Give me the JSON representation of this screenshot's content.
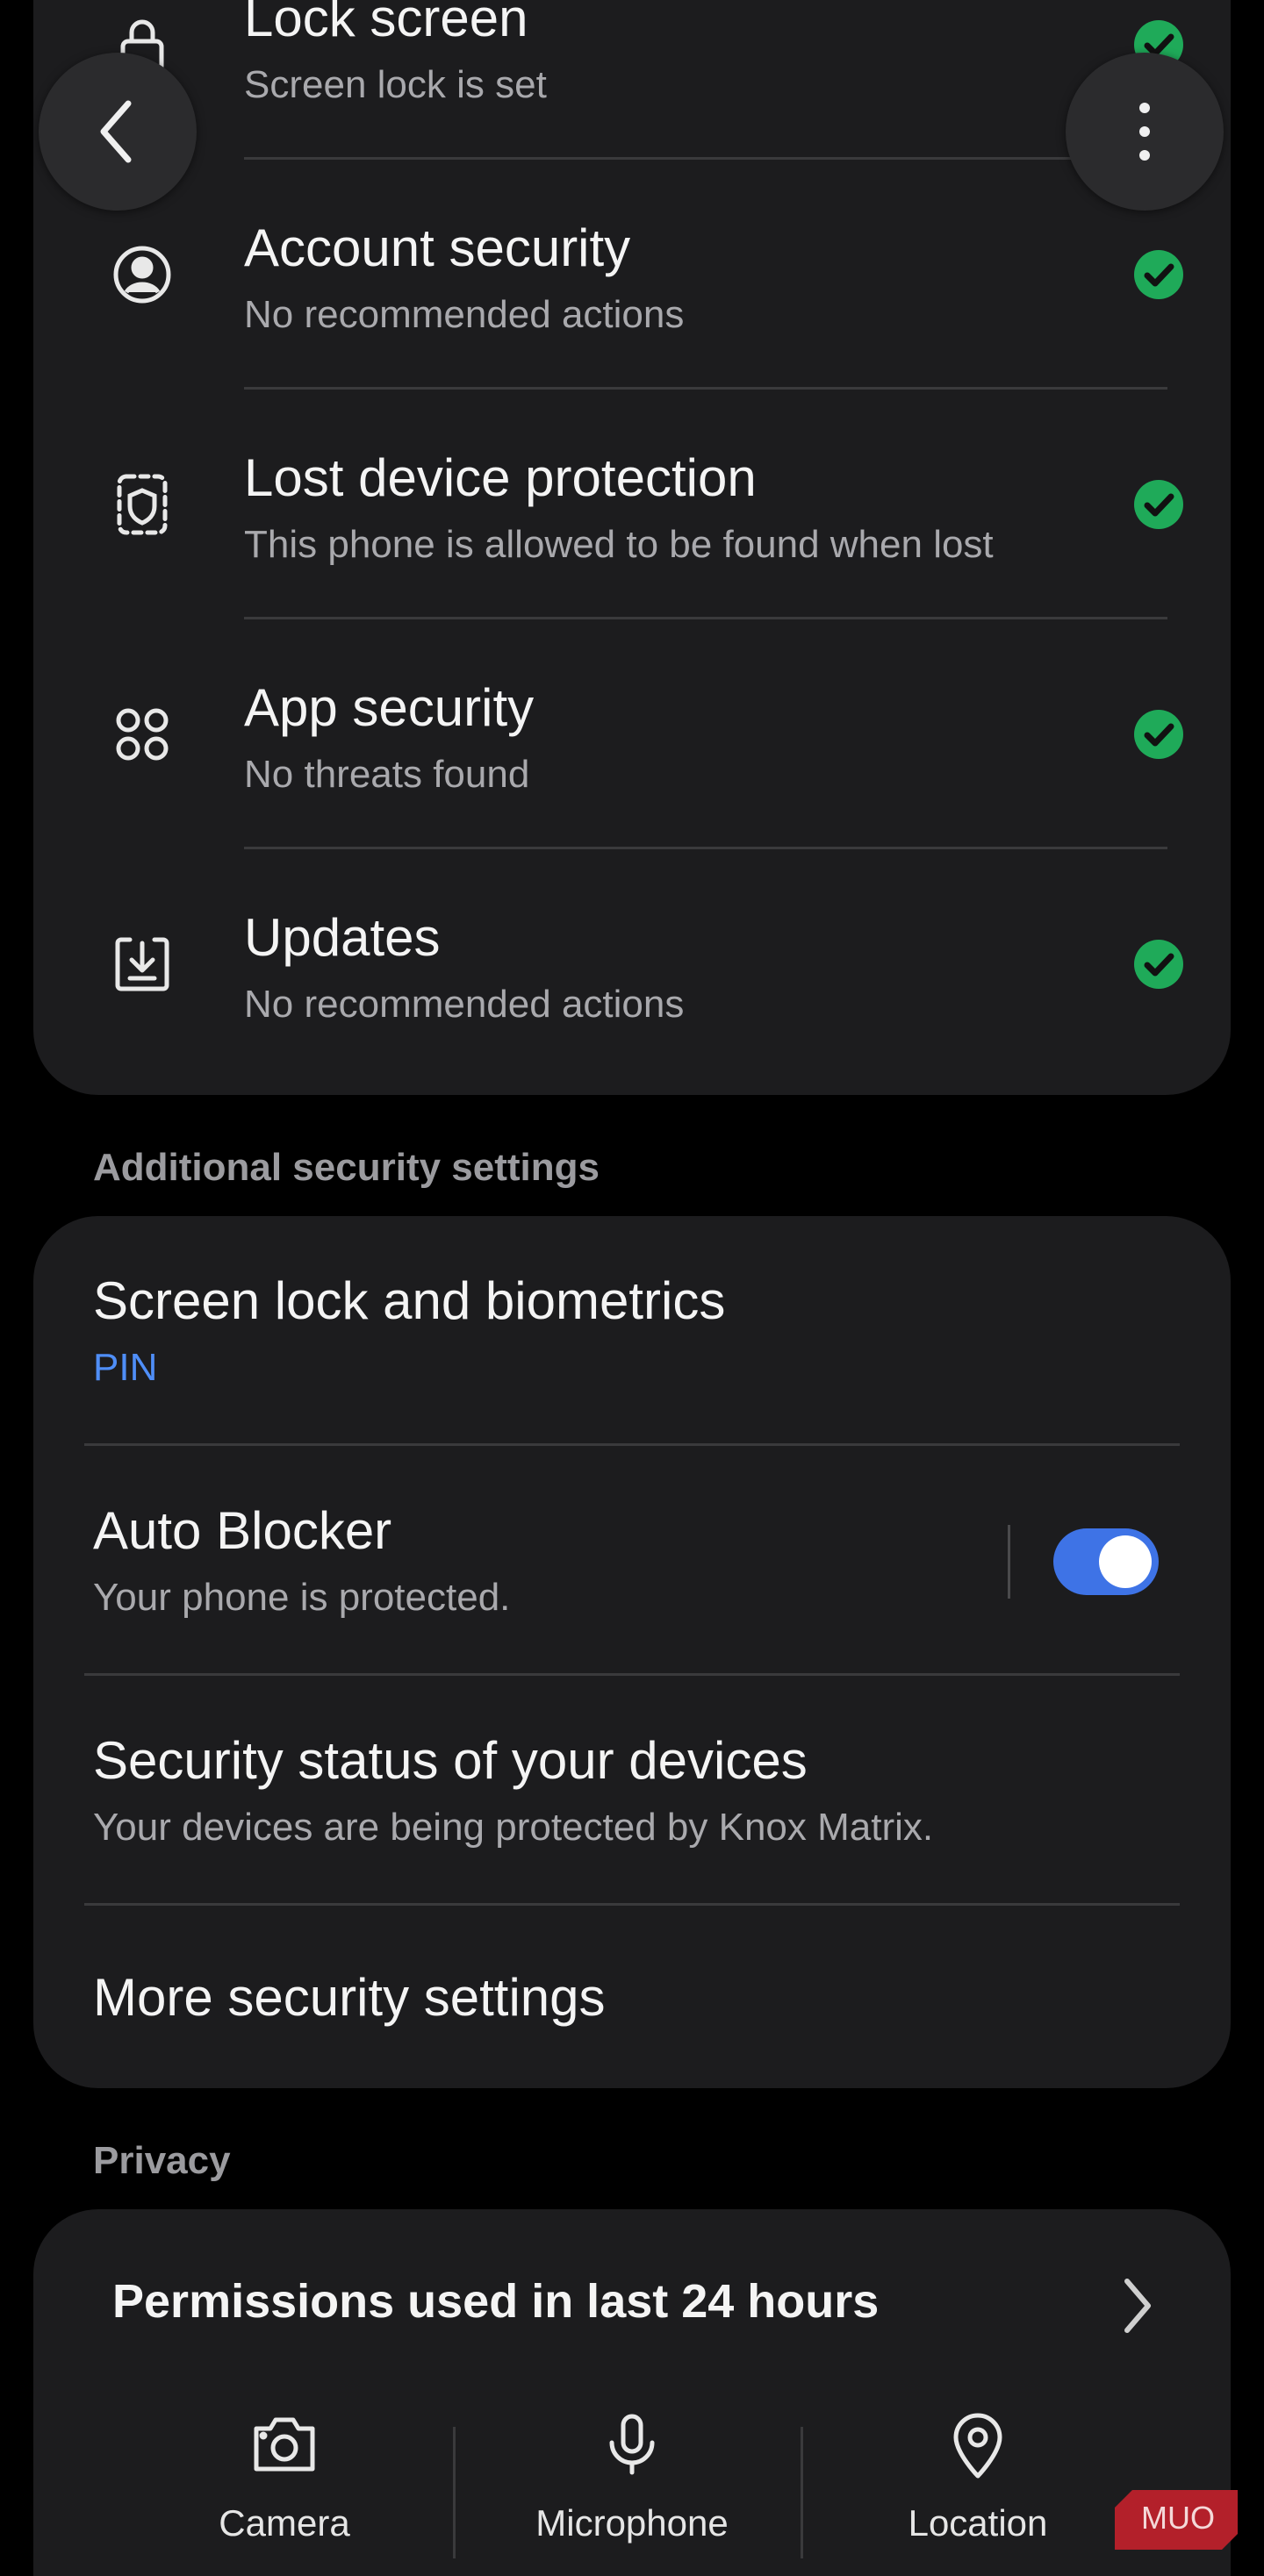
{
  "security_checks": [
    {
      "title": "Lock screen",
      "subtitle": "Screen lock is set",
      "icon": "lock-icon",
      "status": "check-icon"
    },
    {
      "title": "Account security",
      "subtitle": "No recommended actions",
      "icon": "account-icon",
      "status": "check-icon"
    },
    {
      "title": "Lost device protection",
      "subtitle": "This phone is allowed to be found when lost",
      "icon": "shield-icon",
      "status": "check-icon"
    },
    {
      "title": "App security",
      "subtitle": "No threats found",
      "icon": "apps-icon",
      "status": "check-icon"
    },
    {
      "title": "Updates",
      "subtitle": "No recommended actions",
      "icon": "download-icon",
      "status": "check-icon"
    }
  ],
  "additional": {
    "header": "Additional security settings",
    "screen_lock": {
      "title": "Screen lock and biometrics",
      "subtitle": "PIN"
    },
    "auto_blocker": {
      "title": "Auto Blocker",
      "subtitle": "Your phone is protected.",
      "enabled": true
    },
    "devices": {
      "title": "Security status of your devices",
      "subtitle": "Your devices are being protected by Knox Matrix."
    },
    "more": {
      "title": "More security settings"
    }
  },
  "privacy": {
    "header": "Privacy",
    "permissions_title": "Permissions used in last 24 hours",
    "items": [
      {
        "label": "Camera",
        "icon": "camera-icon"
      },
      {
        "label": "Microphone",
        "icon": "microphone-icon"
      },
      {
        "label": "Location",
        "icon": "location-icon"
      }
    ]
  },
  "watermark": "MUO",
  "colors": {
    "background": "#000000",
    "card": "#1c1c1e",
    "check_green": "#1faa59",
    "accent_blue": "#4f8ef7",
    "toggle_on": "#3e73e6",
    "watermark_red": "#b3202a"
  }
}
